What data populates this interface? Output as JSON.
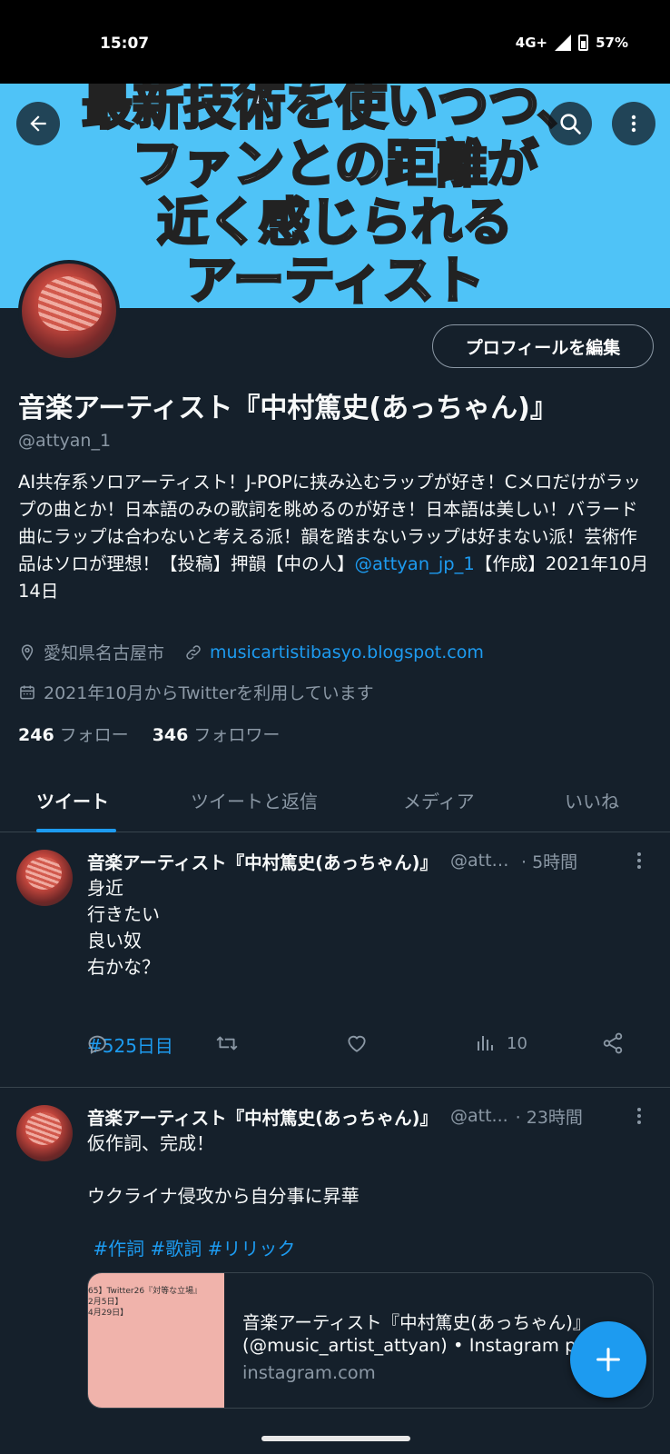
{
  "status_bar": {
    "time": "15:07",
    "network": "4G+",
    "battery": "57%"
  },
  "banner": {
    "lines": [
      "最新技術を使いつつ、",
      "ファンとの距離が",
      "近く感じられる",
      "アーティスト"
    ],
    "bg_color": "#4fc3f7"
  },
  "header_buttons": {
    "back": "arrow-left-icon",
    "search": "search-icon",
    "more": "more-vertical-icon"
  },
  "profile": {
    "edit_button": "プロフィールを編集",
    "display_name": "音楽アーティスト『中村篤史(あっちゃん)』",
    "handle": "@attyan_1",
    "bio_text": "AI共存系ソロアーティスト！J-POPに挟み込むラップが好き！Cメロだけがラップの曲とか！日本語のみの歌詞を眺めるのが好き！日本語は美しい！バラード曲にラップは合わないと考える派！韻を踏まないラップは好まない派！芸術作品はソロが理想！【投稿】押韻【中の人】",
    "bio_link": "@attyan_jp_1",
    "bio_suffix": "【作成】2021年10月14日",
    "location": "愛知県名古屋市",
    "website": "musicartistibasyo.blogspot.com",
    "joined": "2021年10月からTwitterを利用しています",
    "following_count": "246",
    "following_label": "フォロー",
    "followers_count": "346",
    "followers_label": "フォロワー"
  },
  "tabs": [
    {
      "label": "ツイート",
      "active": true
    },
    {
      "label": "ツイートと返信",
      "active": false
    },
    {
      "label": "メディア",
      "active": false
    },
    {
      "label": "いいね",
      "active": false
    }
  ],
  "tweets": [
    {
      "name": "音楽アーティスト『中村篤史(あっちゃん)』",
      "handle": "@atty...",
      "time": "· 5時間",
      "body": "身近\n行きたい\n良い奴\n右かな？",
      "hashtags": "#525日目",
      "views": "10"
    },
    {
      "name": "音楽アーティスト『中村篤史(あっちゃん)』",
      "handle": "@att...",
      "time": "· 23時間",
      "body": "仮作詞、完成！\n\nウクライナ侵攻から自分事に昇華",
      "hashtags": "#作詞 #歌詞 #リリック",
      "card": {
        "thumb_text": "65】Twitter26『対等な立場』\n2月5日】\n4月29日】",
        "title": "音楽アーティスト『中村篤史(あっちゃん)』",
        "subtitle": "(@music_artist_attyan) • Instagram ph",
        "domain": "instagram.com"
      }
    }
  ],
  "colors": {
    "background": "#15202b",
    "accent": "#1d9bf0",
    "muted": "#8b98a5",
    "divider": "#38444d"
  }
}
